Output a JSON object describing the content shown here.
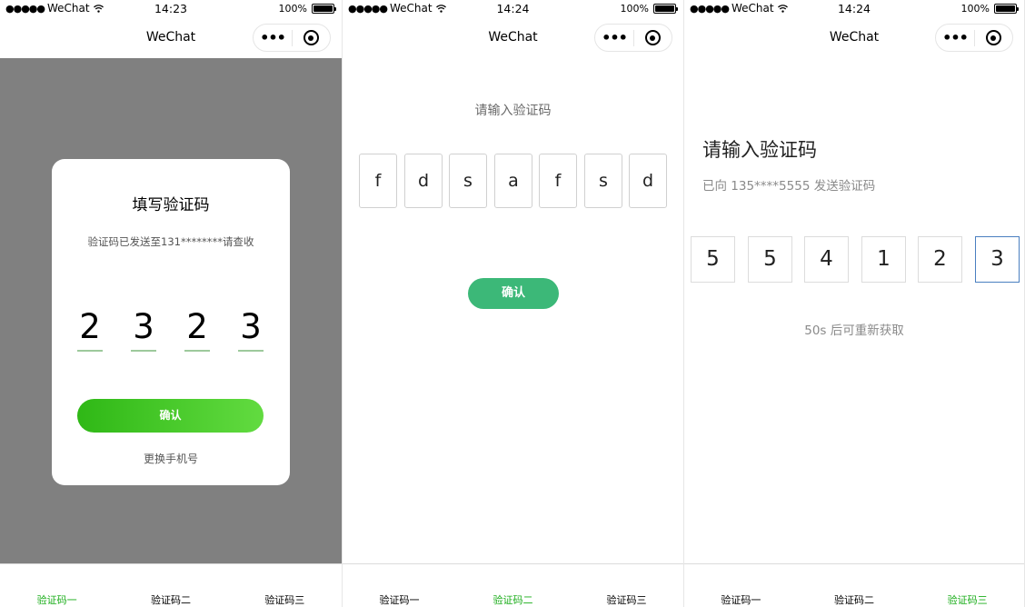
{
  "screens": [
    {
      "status": {
        "carrier": "WeChat",
        "time": "14:23",
        "battery": "100%"
      },
      "nav": {
        "title": "WeChat",
        "more": "•••"
      },
      "dialog": {
        "title": "填写验证码",
        "subtitle": "验证码已发送至131********请查收",
        "digits": [
          "2",
          "3",
          "2",
          "3"
        ],
        "confirm_label": "确认",
        "change_phone_label": "更换手机号"
      },
      "tabs": [
        {
          "label": "验证码一",
          "active": true
        },
        {
          "label": "验证码二",
          "active": false
        },
        {
          "label": "验证码三",
          "active": false
        }
      ]
    },
    {
      "status": {
        "carrier": "WeChat",
        "time": "14:24",
        "battery": "100%"
      },
      "nav": {
        "title": "WeChat",
        "more": "•••"
      },
      "prompt": "请输入验证码",
      "code_chars": [
        "f",
        "d",
        "s",
        "a",
        "f",
        "s",
        "d"
      ],
      "confirm_label": "确认",
      "tabs": [
        {
          "label": "验证码一",
          "active": false
        },
        {
          "label": "验证码二",
          "active": true
        },
        {
          "label": "验证码三",
          "active": false
        }
      ]
    },
    {
      "status": {
        "carrier": "WeChat",
        "time": "14:24",
        "battery": "100%"
      },
      "nav": {
        "title": "WeChat",
        "more": "•••"
      },
      "title": "请输入验证码",
      "subtitle": "已向 135****5555 发送验证码",
      "code_digits": [
        "5",
        "5",
        "4",
        "1",
        "2",
        "3"
      ],
      "resend_text": "50s 后可重新获取",
      "tabs": [
        {
          "label": "验证码一",
          "active": false
        },
        {
          "label": "验证码二",
          "active": false
        },
        {
          "label": "验证码三",
          "active": true
        }
      ]
    }
  ],
  "colors": {
    "tab_active": "#1aad19",
    "mask": "#808080",
    "confirm_gradient_start": "#2fb816",
    "confirm_gradient_end": "#62db40",
    "confirm_green": "#3cb878",
    "digit_underline": "#9dc99c",
    "focus_border": "#4a7fc0"
  },
  "icons": {
    "signal": "signal-dots-icon",
    "wifi": "wifi-icon",
    "battery": "battery-icon",
    "more": "more-dots-icon",
    "close": "target-circle-icon"
  }
}
